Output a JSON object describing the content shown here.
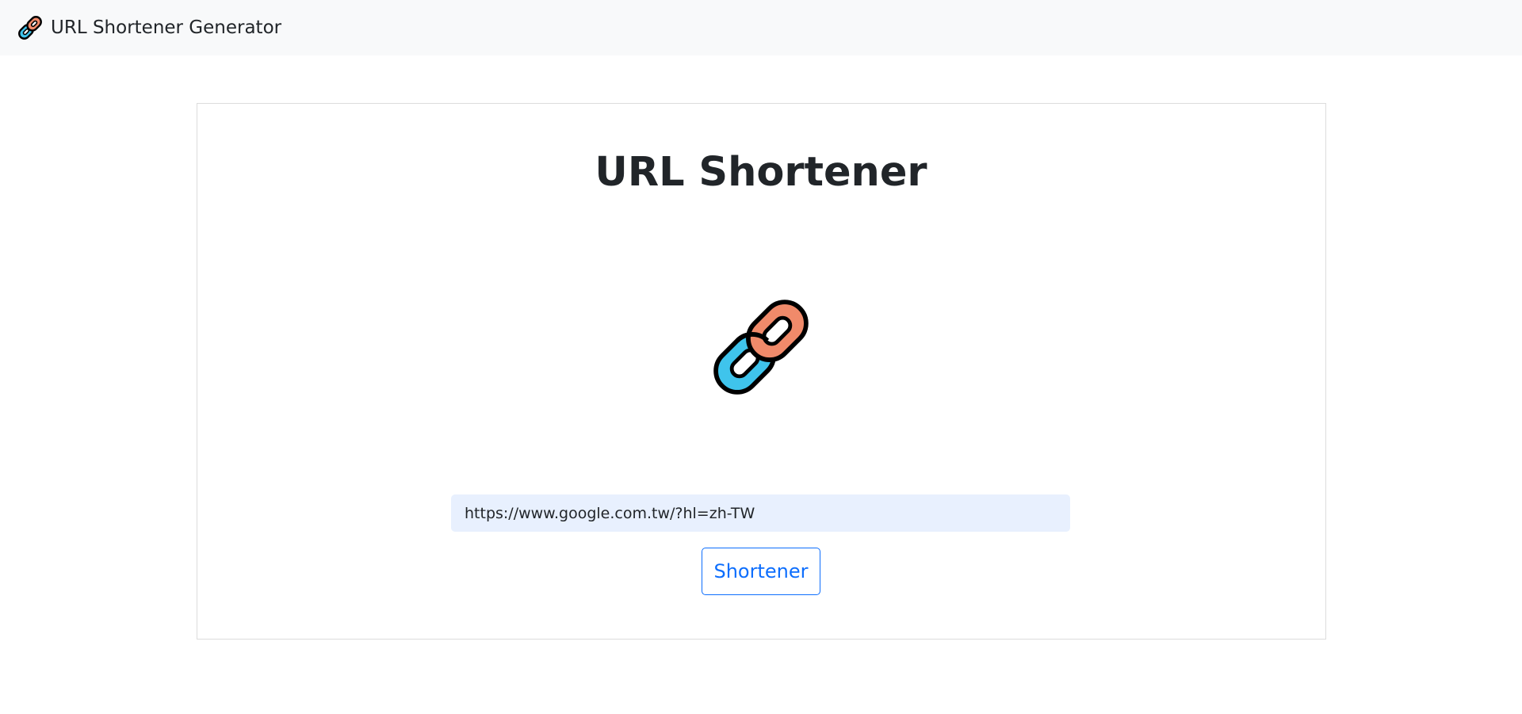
{
  "navbar": {
    "brand_label": "URL Shortener Generator",
    "brand_icon": "link-icon"
  },
  "main": {
    "title": "URL Shortener",
    "hero_icon": "link-icon",
    "url_input": {
      "value": "https://www.google.com.tw/?hl=zh-TW",
      "placeholder": ""
    },
    "submit_label": "Shortener"
  },
  "colors": {
    "navbar_bg": "#f8f9fa",
    "link_orange": "#f08a6a",
    "link_blue": "#3fc4ec",
    "button_accent": "#0d6efd",
    "input_bg": "#e8f0fe"
  }
}
